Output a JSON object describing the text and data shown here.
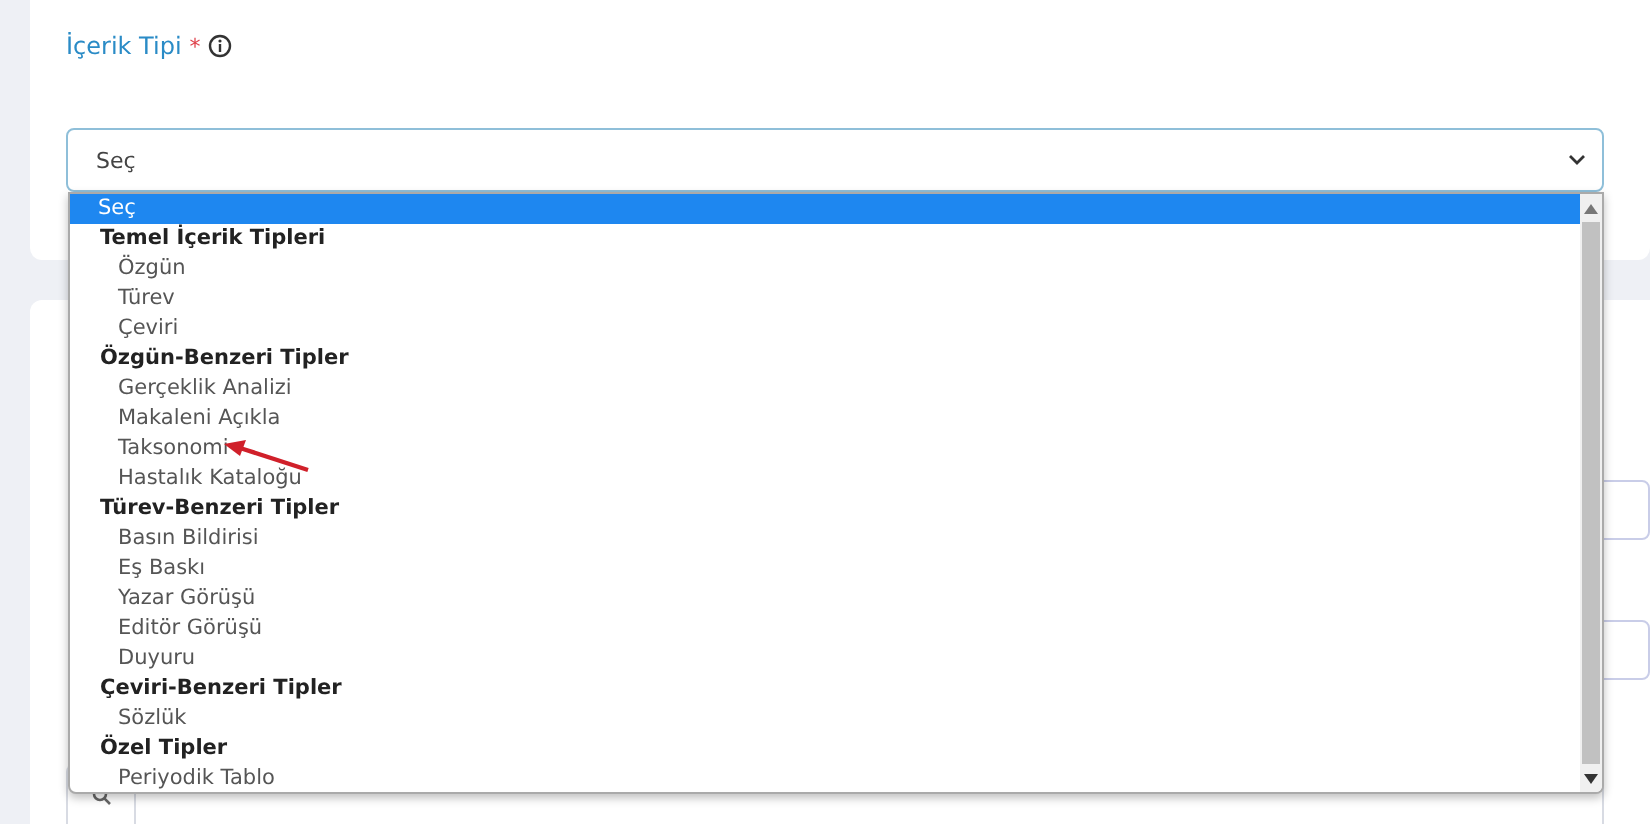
{
  "field": {
    "label": "İçerik Tipi",
    "required_mark": "*",
    "value": "Seç",
    "expanded": true
  },
  "dropdown": {
    "options": [
      {
        "label": "Seç",
        "selected": true
      }
    ],
    "groups": [
      {
        "label": "Temel İçerik Tipleri",
        "options": [
          {
            "label": "Özgün",
            "selected": false
          },
          {
            "label": "Türev",
            "selected": false
          },
          {
            "label": "Çeviri",
            "selected": false
          }
        ]
      },
      {
        "label": "Özgün-Benzeri Tipler",
        "options": [
          {
            "label": "Gerçeklik Analizi",
            "selected": false
          },
          {
            "label": "Makaleni Açıkla",
            "selected": false
          },
          {
            "label": "Taksonomi",
            "selected": false
          },
          {
            "label": "Hastalık Kataloğu",
            "selected": false
          }
        ]
      },
      {
        "label": "Türev-Benzeri Tipler",
        "options": [
          {
            "label": "Basın Bildirisi",
            "selected": false
          },
          {
            "label": "Eş Baskı",
            "selected": false
          },
          {
            "label": "Yazar Görüşü",
            "selected": false
          },
          {
            "label": "Editör Görüşü",
            "selected": false
          },
          {
            "label": "Duyuru",
            "selected": false
          }
        ]
      },
      {
        "label": "Çeviri-Benzeri Tipler",
        "options": [
          {
            "label": "Sözlük",
            "selected": false
          }
        ]
      },
      {
        "label": "Özel Tipler",
        "options": [
          {
            "label": "Periyodik Tablo",
            "selected": false
          }
        ]
      }
    ]
  }
}
